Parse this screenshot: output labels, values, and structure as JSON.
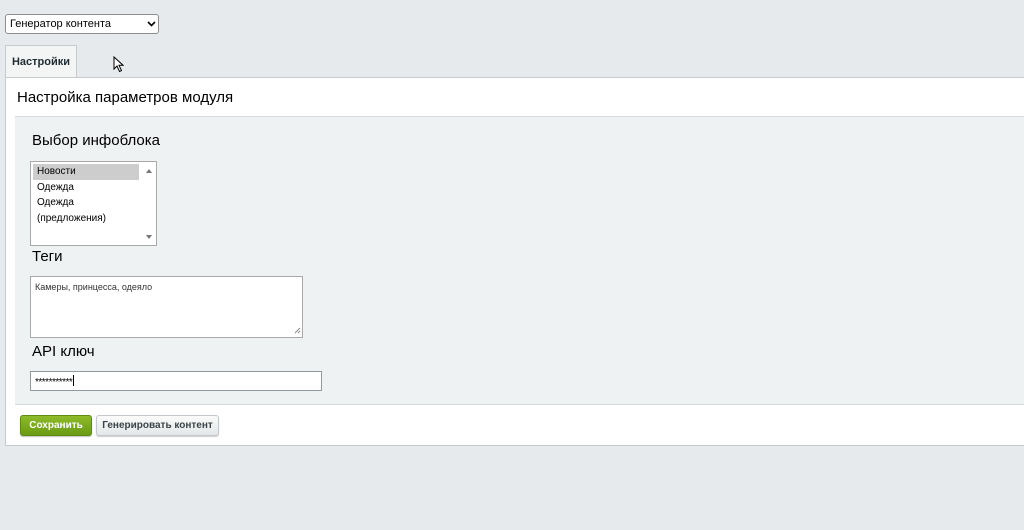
{
  "module_select": {
    "selected": "Генератор контента"
  },
  "tabs": [
    {
      "label": "Настройки"
    }
  ],
  "panel": {
    "title": "Настройка параметров модуля"
  },
  "infoblock": {
    "label": "Выбор инфоблока",
    "options": [
      "Новости",
      "Одежда",
      "Одежда (предложения)"
    ],
    "selected": "Новости"
  },
  "tags": {
    "label": "Теги",
    "value": "Камеры, принцесса, одеяло"
  },
  "api_key": {
    "label": "API ключ",
    "value": "***********"
  },
  "buttons": {
    "save": "Сохранить",
    "generate": "Генерировать контент"
  },
  "colors": {
    "save_green": "#7aab1e",
    "background": "#e7eaec",
    "inner_panel": "#eef2f3"
  }
}
